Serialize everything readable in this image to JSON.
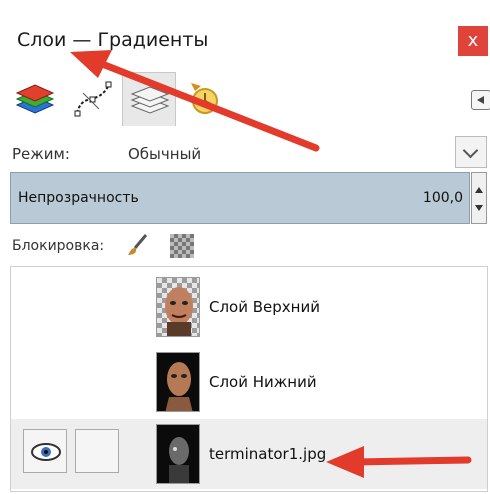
{
  "window": {
    "title": "Слои — Градиенты",
    "close_glyph": "x"
  },
  "tabs": [
    {
      "icon": "layers-icon"
    },
    {
      "icon": "paths-icon"
    },
    {
      "icon": "channels-icon"
    },
    {
      "icon": "undo-history-icon"
    }
  ],
  "mode": {
    "label": "Режим:",
    "value": "Обычный"
  },
  "opacity": {
    "label": "Непрозрачность",
    "value": "100,0"
  },
  "lock": {
    "label": "Блокировка:"
  },
  "layers": [
    {
      "name": "Слой Верхний",
      "visible": false,
      "thumb": "checker"
    },
    {
      "name": "Слой Нижний",
      "visible": false,
      "thumb": "dark"
    },
    {
      "name": "terminator1.jpg",
      "visible": true,
      "thumb": "dark",
      "selected": true
    }
  ],
  "colors": {
    "arrow": "#e23a2b",
    "close": "#e0433a",
    "slider": "#b9c9d5"
  }
}
